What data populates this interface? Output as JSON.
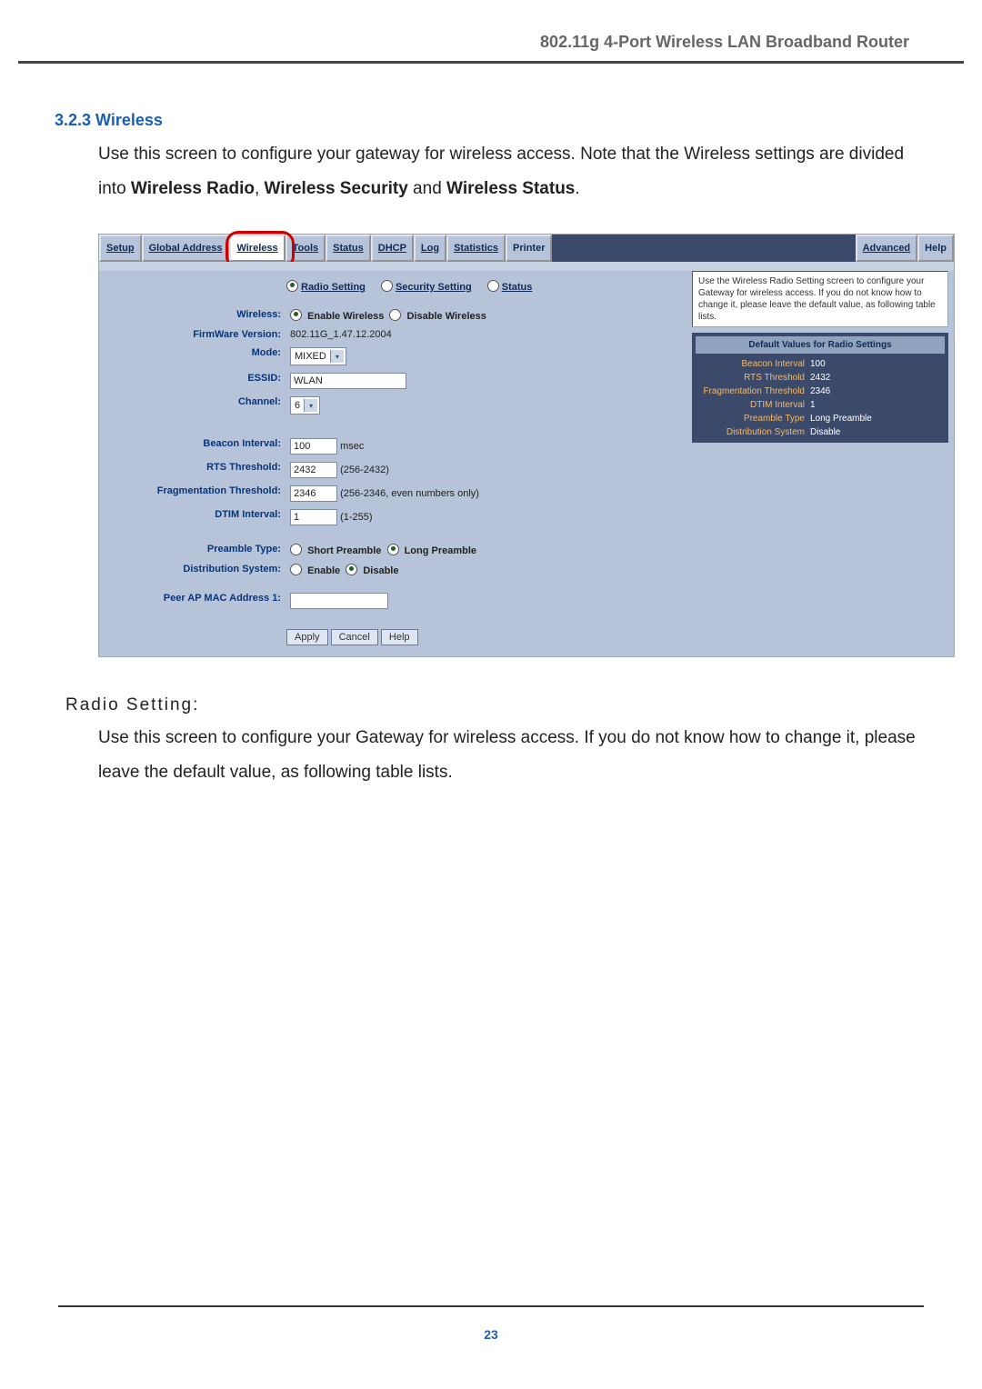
{
  "header": "802.11g 4-Port Wireless LAN Broadband Router",
  "section_num": "3.2.3 Wireless",
  "intro_1": "Use this screen to configure your gateway for wireless access. Note that the Wireless settings are divided into ",
  "intro_b1": "Wireless Radio",
  "intro_sep1": ", ",
  "intro_b2": "Wireless Security",
  "intro_sep2": " and ",
  "intro_b3": "Wireless Status",
  "intro_end": ".",
  "tabs": {
    "setup": "Setup",
    "global": "Global Address",
    "wireless": "Wireless",
    "tools": "Tools",
    "status": "Status",
    "dhcp": "DHCP",
    "log": "Log",
    "stats": "Statistics",
    "printer": "Printer",
    "advanced": "Advanced",
    "help": "Help"
  },
  "subtabs": {
    "radio": "Radio Setting",
    "security": "Security Setting",
    "status": "Status"
  },
  "labels": {
    "wireless": "Wireless:",
    "fwver": "FirmWare Version:",
    "mode": "Mode:",
    "essid": "ESSID:",
    "channel": "Channel:",
    "beacon": "Beacon Interval:",
    "rts": "RTS Threshold:",
    "frag": "Fragmentation Threshold:",
    "dtim": "DTIM Interval:",
    "preamble": "Preamble Type:",
    "dist": "Distribution System:",
    "peer": "Peer AP MAC Address 1:"
  },
  "values": {
    "enable_wireless": "Enable Wireless",
    "disable_wireless": "Disable Wireless",
    "fwver": "802.11G_1.47.12.2004",
    "mode": "MIXED",
    "essid": "WLAN",
    "channel": "6",
    "beacon": "100",
    "beacon_unit": "msec",
    "rts": "2432",
    "rts_range": "(256-2432)",
    "frag": "2346",
    "frag_range": "(256-2346, even numbers only)",
    "dtim": "1",
    "dtim_range": "(1-255)",
    "short_preamble": "Short Preamble",
    "long_preamble": "Long Preamble",
    "enable": "Enable",
    "disable": "Disable",
    "apply": "Apply",
    "cancel": "Cancel",
    "helpbtn": "Help"
  },
  "help_box": "Use the Wireless Radio Setting screen to configure your Gateway for wireless access. If you do not know how to change it, please leave the default value, as following table lists.",
  "defaults": {
    "hdr": "Default Values for Radio Settings",
    "beacon_k": "Beacon Interval",
    "beacon_v": "100",
    "rts_k": "RTS Threshold",
    "rts_v": "2432",
    "frag_k": "Fragmentation Threshold",
    "frag_v": "2346",
    "dtim_k": "DTIM Interval",
    "dtim_v": "1",
    "preamble_k": "Preamble Type",
    "preamble_v": "Long Preamble",
    "dist_k": "Distribution System",
    "dist_v": "Disable"
  },
  "radio_heading": "Radio Setting:",
  "footer_text": "Use this screen to configure your Gateway for wireless access. If you do not know how to change it, please leave the default value, as following table lists.",
  "page_num": "23"
}
